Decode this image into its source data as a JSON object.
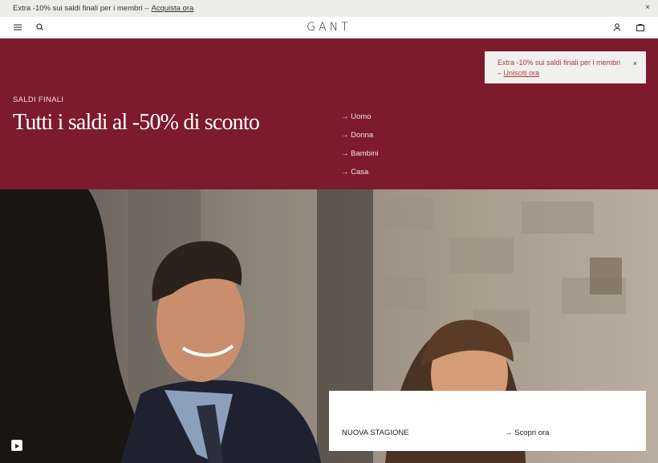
{
  "promo_bar": {
    "text": "Extra -10% sui saldi finali per i membri –",
    "link": "Acquista ora",
    "close_glyph": "×"
  },
  "header": {
    "logo": "GANT",
    "icons": [
      "menu-icon",
      "search-icon",
      "account-icon",
      "bag-icon"
    ]
  },
  "toast": {
    "text": "Extra -10% sui saldi finali per i membri –",
    "link": "Unisciti ora",
    "close_glyph": "×"
  },
  "hero": {
    "subtitle": "SALDI FINALI",
    "title": "Tutti i saldi al -50% di sconto",
    "background": "#7d1a2c",
    "categories": [
      "Uomo",
      "Donna",
      "Bambini",
      "Casa"
    ],
    "arrow": "→"
  },
  "card": {
    "label": "NUOVA STAGIONE",
    "link": "Scopri ora"
  },
  "media": {
    "play_icon": "play-icon"
  }
}
